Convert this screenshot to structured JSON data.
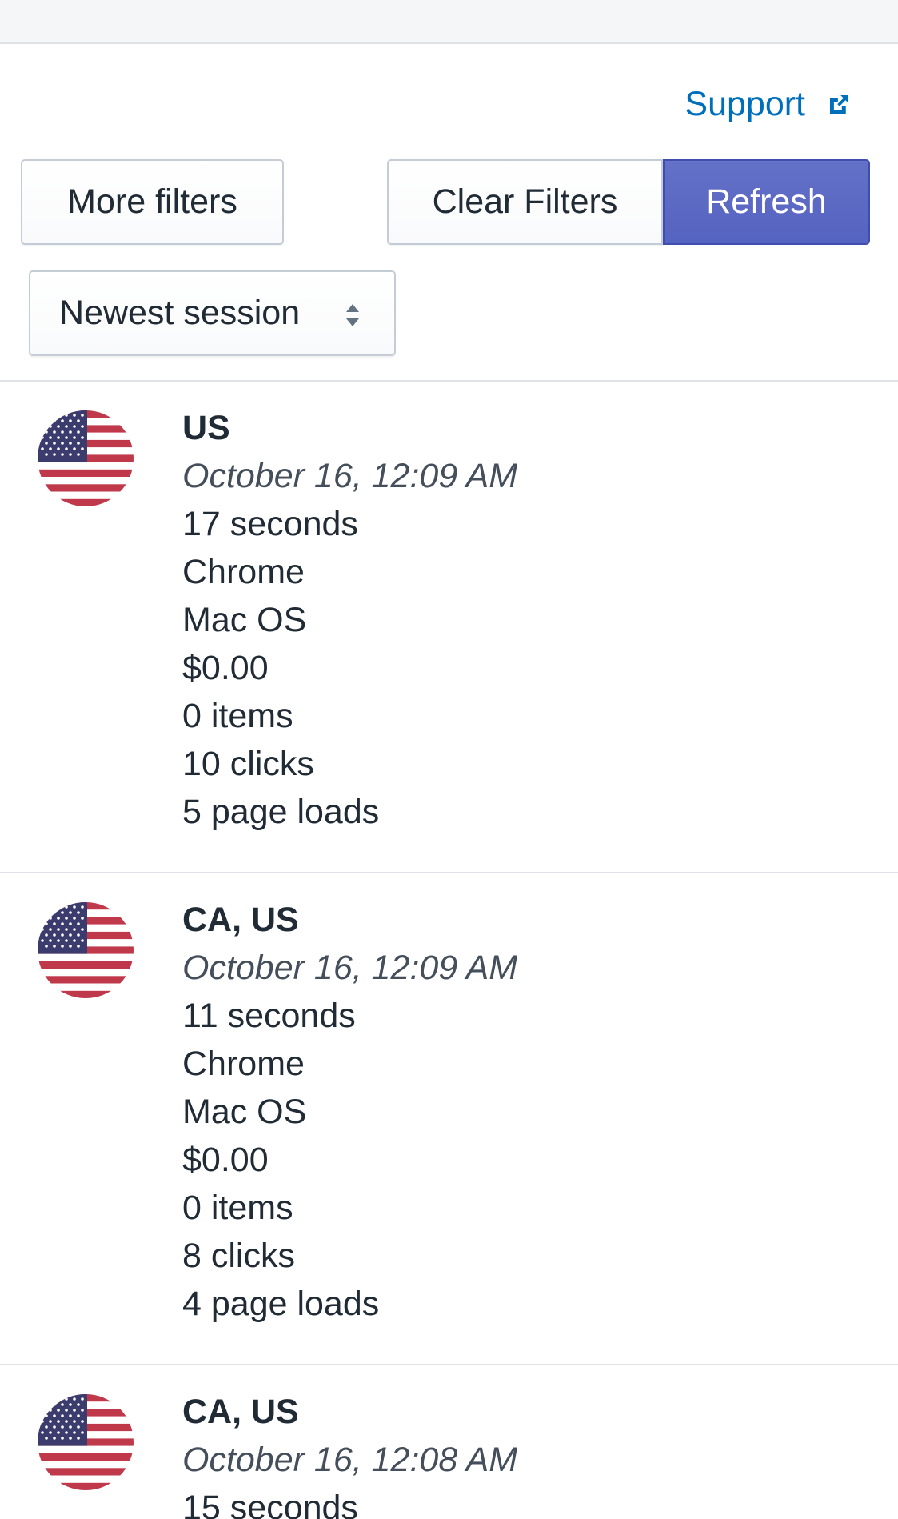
{
  "header": {
    "support_label": "Support"
  },
  "toolbar": {
    "more_filters_label": "More filters",
    "clear_filters_label": "Clear Filters",
    "refresh_label": "Refresh",
    "sort_selected": "Newest session"
  },
  "colors": {
    "link": "#006fbb",
    "primary_button": "#5c6ac4",
    "text": "#212b36",
    "muted_text": "#454f5b"
  },
  "sessions": [
    {
      "flag": "us-flag-icon",
      "location": "US",
      "timestamp": "October 16, 12:09 AM",
      "duration": "17 seconds",
      "browser": "Chrome",
      "os": "Mac OS",
      "value": "$0.00",
      "items": "0 items",
      "clicks": "10 clicks",
      "page_loads": "5 page loads"
    },
    {
      "flag": "us-flag-icon",
      "location": "CA, US",
      "timestamp": "October 16, 12:09 AM",
      "duration": "11 seconds",
      "browser": "Chrome",
      "os": "Mac OS",
      "value": "$0.00",
      "items": "0 items",
      "clicks": "8 clicks",
      "page_loads": "4 page loads"
    },
    {
      "flag": "us-flag-icon",
      "location": "CA, US",
      "timestamp": "October 16, 12:08 AM",
      "duration": "15 seconds"
    }
  ]
}
